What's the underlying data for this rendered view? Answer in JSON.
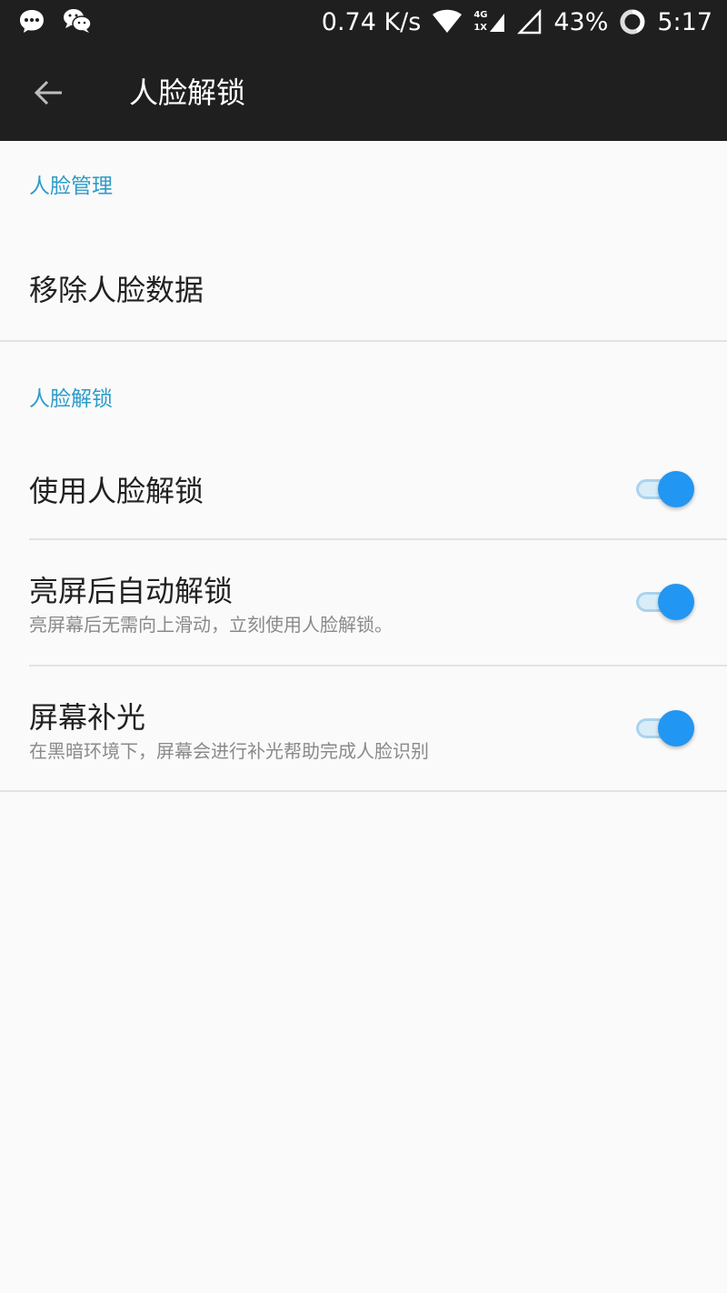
{
  "status_bar": {
    "network_speed": "0.74 K/s",
    "network_type_top": "4G",
    "network_type_bottom": "1X",
    "battery": "43%",
    "time": "5:17",
    "icons": [
      "message-icon",
      "wechat-icon",
      "wifi-icon",
      "signal-icon",
      "signal-empty-icon",
      "battery-ring-icon"
    ]
  },
  "app_bar": {
    "back_icon": "arrow-left-icon",
    "title": "人脸解锁"
  },
  "sections": {
    "face_management": {
      "header": "人脸管理",
      "remove_label": "移除人脸数据"
    },
    "face_unlock": {
      "header": "人脸解锁",
      "use_label": "使用人脸解锁",
      "use_enabled": true,
      "auto_label": "亮屏后自动解锁",
      "auto_sub": "亮屏幕后无需向上滑动，立刻使用人脸解锁。",
      "auto_enabled": true,
      "fill_label": "屏幕补光",
      "fill_sub": "在黑暗环境下，屏幕会进行补光帮助完成人脸识别",
      "fill_enabled": true
    }
  },
  "colors": {
    "accent": "#2196f3",
    "section_header": "#2e9cc9",
    "app_bar": "#1f1f1f"
  }
}
